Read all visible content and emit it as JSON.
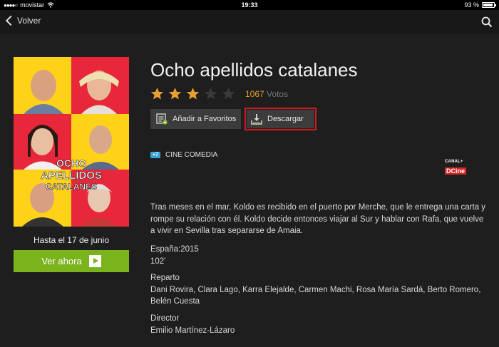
{
  "status_bar": {
    "carrier": "movistar",
    "time": "19:33",
    "battery": "93 %"
  },
  "nav": {
    "back_label": "Volver"
  },
  "movie": {
    "title": "Ocho apellidos catalanes",
    "rating_stars": 3,
    "max_stars": 5,
    "votes_count": "1067",
    "votes_label": "Votos",
    "age_rating": "+7",
    "genre": "CINE COMEDIA",
    "synopsis": "Tras meses en el mar, Koldo es recibido en el puerto por Merche, que le entrega una carta y rompe su relación con él. Koldo decide entonces viajar al Sur y hablar con Rafa, que vuelve a vivir en Sevilla tras separarse de Amaia.",
    "country_year": "España:2015",
    "duration": "102'",
    "cast_label": "Reparto",
    "cast": "Dani Rovira, Clara Lago, Karra Elejalde, Carmen Machi, Rosa María Sardá, Berto Romero, Belén Cuesta",
    "director_label": "Director",
    "director": "Emilio Martínez-Lázaro",
    "availability": "Hasta el 17 de junio"
  },
  "poster": {
    "line1": "OCHO",
    "line2": "APELLIDOS",
    "line3": "CATALANES"
  },
  "actions": {
    "favorites_label": "Añadir a Favoritos",
    "download_label": "Descargar",
    "watch_label": "Ver ahora"
  },
  "channel": {
    "top": "CANAL+",
    "bottom": "DCine"
  },
  "colors": {
    "accent_green": "#7bb31c",
    "star_active": "#e8a030",
    "highlight_red": "#d3181e",
    "badge_blue": "#3aa0d8"
  }
}
